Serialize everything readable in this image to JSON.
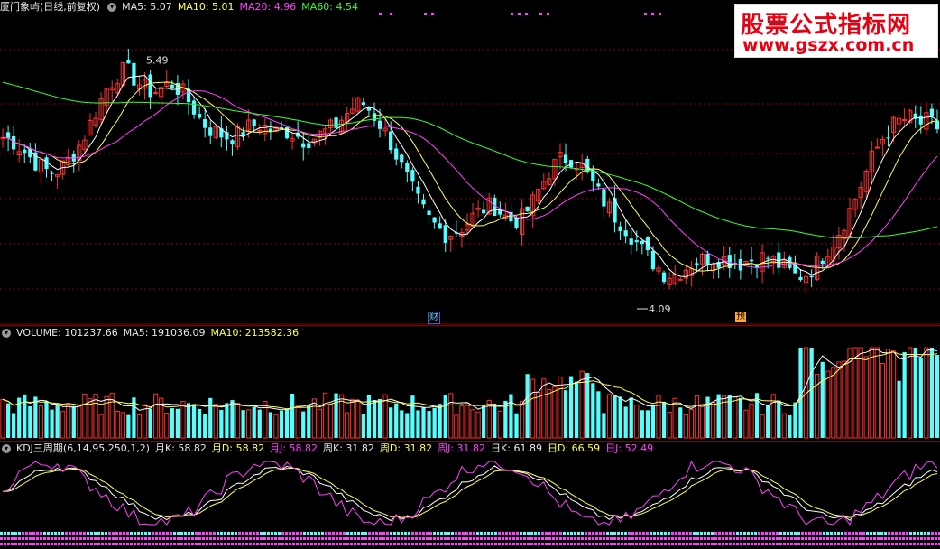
{
  "price_header": {
    "stock": "厦门象屿(日线,前复权)",
    "ma5": "MA5: 5.07",
    "ma10": "MA10: 5.01",
    "ma20": "MA20: 4.96",
    "ma60": "MA60: 4.54"
  },
  "price_annotations": {
    "high": "5.49",
    "low": "4.09"
  },
  "markers": {
    "cai": "财",
    "yu": "预"
  },
  "volume_header": {
    "volume": "VOLUME: 101237.66",
    "ma5": "MA5: 191036.09",
    "ma10": "MA10: 213582.36"
  },
  "kdj_header": {
    "title": "KDJ三周期(6,14,95,250,1,2)",
    "month_k": "月K: 58.82",
    "month_d": "月D: 58.82",
    "month_j": "月J: 58.82",
    "week_k": "周K: 31.82",
    "week_d": "周D: 31.82",
    "week_j": "周J: 31.82",
    "day_k": "日K: 61.89",
    "day_d": "日D: 66.59",
    "day_j": "日J: 52.49"
  },
  "logo": {
    "line1": "股票公式指标网",
    "line2": "www.gszx.com.cn"
  },
  "colors": {
    "up": "#ff3030",
    "down": "#54ffff",
    "ma5": "#ffffff",
    "ma10": "#ffff55",
    "ma20": "#ff40ff",
    "ma60": "#33ff33",
    "grid": "#8b0000"
  },
  "chart_data": {
    "type": "line",
    "price_series": [
      5.0,
      4.98,
      4.93,
      4.87,
      4.82,
      4.78,
      4.8,
      4.86,
      4.94,
      5.05,
      5.18,
      5.3,
      5.38,
      5.42,
      5.36,
      5.3,
      5.28,
      5.31,
      5.33,
      5.28,
      5.2,
      5.1,
      5.05,
      5.02,
      5.0,
      5.02,
      5.06,
      5.08,
      5.06,
      5.03,
      5.04,
      5.02,
      4.98,
      5.0,
      5.03,
      5.06,
      5.12,
      5.18,
      5.22,
      5.16,
      5.08,
      4.98,
      4.85,
      4.72,
      4.6,
      4.5,
      4.44,
      4.4,
      4.42,
      4.46,
      4.52,
      4.56,
      4.58,
      4.52,
      4.48,
      4.5,
      4.58,
      4.7,
      4.8,
      4.86,
      4.88,
      4.84,
      4.76,
      4.66,
      4.58,
      4.5,
      4.44,
      4.36,
      4.28,
      4.22,
      4.16,
      4.15,
      4.18,
      4.22,
      4.24,
      4.26,
      4.25,
      4.24,
      4.22,
      4.24,
      4.25,
      4.26,
      4.22,
      4.18,
      4.14,
      4.15,
      4.2,
      4.28,
      4.36,
      4.46,
      4.58,
      4.72,
      4.86,
      4.98,
      5.06,
      5.1,
      5.12,
      5.08,
      5.1,
      5.06
    ],
    "annotations": {
      "high": 5.49,
      "low": 4.09
    }
  }
}
